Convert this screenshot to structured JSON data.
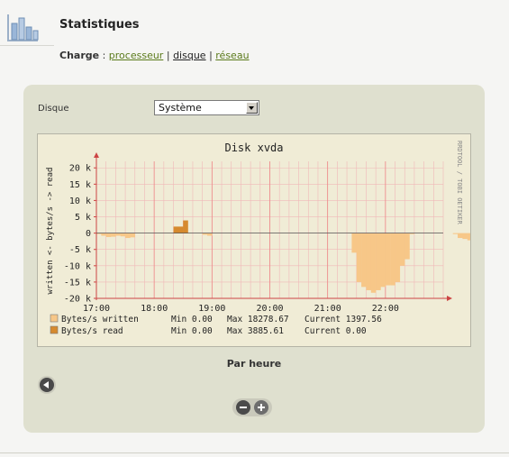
{
  "header": {
    "title": "Statistiques"
  },
  "charge": {
    "label": "Charge",
    "separator_colon": " : ",
    "links": [
      "processeur",
      "disque",
      "réseau"
    ],
    "active": "disque",
    "separator": "|"
  },
  "form": {
    "disk_label": "Disque",
    "disk_selected": "Système"
  },
  "graph": {
    "title": "Disk xvda",
    "side_text": "RRDTOOL / TOBI OETIKER",
    "legend": [
      {
        "name": "Bytes/s written",
        "min": "Min 0.00",
        "max": "Max 18278.67",
        "current": "Current 1397.56",
        "color": "#f7c788"
      },
      {
        "name": "Bytes/s read",
        "min": "Min 0.00",
        "max": "Max 3885.61",
        "current": "Current 0.00",
        "color": "#d68a2e"
      }
    ]
  },
  "chart_data": {
    "type": "bar",
    "title": "Disk xvda",
    "ylabel": "written <- bytes/s -> read",
    "xlabel": "",
    "ylim": [
      -20000,
      22000
    ],
    "yticks": [
      "20 k",
      "15 k",
      "10 k",
      "5 k",
      "0",
      "-5 k",
      "-10 k",
      "-15 k",
      "-20 k"
    ],
    "xticks": [
      "17:00",
      "18:00",
      "19:00",
      "20:00",
      "21:00",
      "22:00"
    ],
    "grid": true,
    "x": [
      "17:05",
      "17:10",
      "17:15",
      "17:20",
      "17:25",
      "17:30",
      "17:35",
      "17:40",
      "17:45",
      "17:50",
      "17:55",
      "18:00",
      "18:05",
      "18:10",
      "18:15",
      "18:20",
      "18:25",
      "18:30",
      "18:35",
      "18:40",
      "18:45",
      "18:50",
      "18:55",
      "19:00",
      "19:05",
      "19:10",
      "19:15",
      "19:20",
      "19:25",
      "19:30",
      "19:35",
      "19:40",
      "19:45",
      "19:50",
      "19:55",
      "20:00",
      "20:05",
      "20:10",
      "20:15",
      "20:20",
      "20:25",
      "20:30",
      "20:35",
      "20:40",
      "20:45",
      "20:50",
      "20:55",
      "21:00",
      "21:05",
      "21:10",
      "21:15",
      "21:20",
      "21:25",
      "21:30",
      "21:35",
      "21:40",
      "21:45",
      "21:50",
      "21:55",
      "22:00",
      "22:05",
      "22:10",
      "22:15",
      "22:20",
      "22:25",
      "22:30",
      "22:35",
      "22:40",
      "22:45",
      "22:50",
      "22:55",
      "23:00"
    ],
    "series": [
      {
        "name": "Bytes/s written",
        "color": "#f7c788",
        "values": [
          300,
          800,
          1200,
          1100,
          800,
          1000,
          1500,
          1300,
          0,
          0,
          0,
          0,
          0,
          0,
          0,
          0,
          0,
          0,
          0,
          0,
          0,
          0,
          500,
          800,
          0,
          0,
          0,
          0,
          0,
          0,
          0,
          0,
          0,
          0,
          0,
          0,
          0,
          0,
          0,
          0,
          0,
          0,
          0,
          0,
          0,
          0,
          0,
          0,
          0,
          0,
          0,
          0,
          0,
          6000,
          15000,
          16500,
          17500,
          18279,
          17500,
          16500,
          16000,
          16000,
          15000,
          10000,
          8000,
          300,
          0,
          0,
          0,
          0,
          0,
          0,
          0,
          0,
          300,
          1500,
          1800,
          2200,
          1400
        ]
      },
      {
        "name": "Bytes/s read",
        "color": "#d68a2e",
        "values": [
          0,
          0,
          0,
          0,
          0,
          0,
          0,
          0,
          0,
          0,
          0,
          0,
          0,
          0,
          0,
          0,
          2000,
          2000,
          3886,
          0,
          0,
          0,
          0,
          0,
          0,
          0,
          0,
          0,
          0,
          0,
          0,
          0,
          0,
          0,
          0,
          0,
          0,
          0,
          0,
          0,
          0,
          0,
          0,
          0,
          0,
          0,
          0,
          0,
          0,
          0,
          0,
          0,
          0,
          0,
          0,
          0,
          0,
          0,
          0,
          0,
          0,
          0,
          0,
          0,
          0,
          0,
          0,
          0,
          0,
          0,
          0,
          0,
          0,
          0,
          0,
          0,
          0,
          0
        ]
      }
    ]
  },
  "footer": {
    "period": "Par heure"
  }
}
